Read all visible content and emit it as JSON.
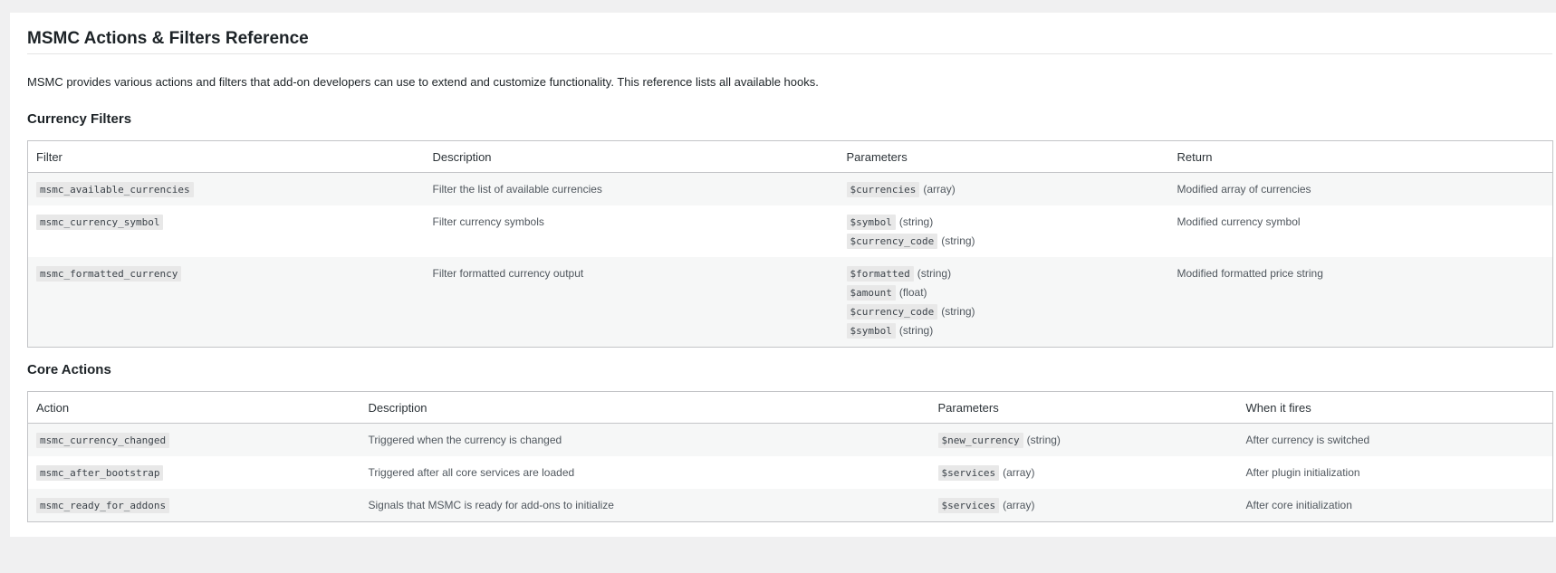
{
  "page": {
    "title": "MSMC Actions & Filters Reference",
    "intro": "MSMC provides various actions and filters that add-on developers can use to extend and customize functionality. This reference lists all available hooks."
  },
  "filters": {
    "heading": "Currency Filters",
    "columns": [
      "Filter",
      "Description",
      "Parameters",
      "Return"
    ],
    "rows": [
      {
        "name": "msmc_available_currencies",
        "description": "Filter the list of available currencies",
        "params": [
          {
            "name": "$currencies",
            "type": "(array)"
          }
        ],
        "return": "Modified array of currencies"
      },
      {
        "name": "msmc_currency_symbol",
        "description": "Filter currency symbols",
        "params": [
          {
            "name": "$symbol",
            "type": "(string)"
          },
          {
            "name": "$currency_code",
            "type": "(string)"
          }
        ],
        "return": "Modified currency symbol"
      },
      {
        "name": "msmc_formatted_currency",
        "description": "Filter formatted currency output",
        "params": [
          {
            "name": "$formatted",
            "type": "(string)"
          },
          {
            "name": "$amount",
            "type": "(float)"
          },
          {
            "name": "$currency_code",
            "type": "(string)"
          },
          {
            "name": "$symbol",
            "type": "(string)"
          }
        ],
        "return": "Modified formatted price string"
      }
    ]
  },
  "actions": {
    "heading": "Core Actions",
    "columns": [
      "Action",
      "Description",
      "Parameters",
      "When it fires"
    ],
    "rows": [
      {
        "name": "msmc_currency_changed",
        "description": "Triggered when the currency is changed",
        "params": [
          {
            "name": "$new_currency",
            "type": "(string)"
          }
        ],
        "when": "After currency is switched"
      },
      {
        "name": "msmc_after_bootstrap",
        "description": "Triggered after all core services are loaded",
        "params": [
          {
            "name": "$services",
            "type": "(array)"
          }
        ],
        "when": "After plugin initialization"
      },
      {
        "name": "msmc_ready_for_addons",
        "description": "Signals that MSMC is ready for add-ons to initialize",
        "params": [
          {
            "name": "$services",
            "type": "(array)"
          }
        ],
        "when": "After core initialization"
      }
    ]
  }
}
